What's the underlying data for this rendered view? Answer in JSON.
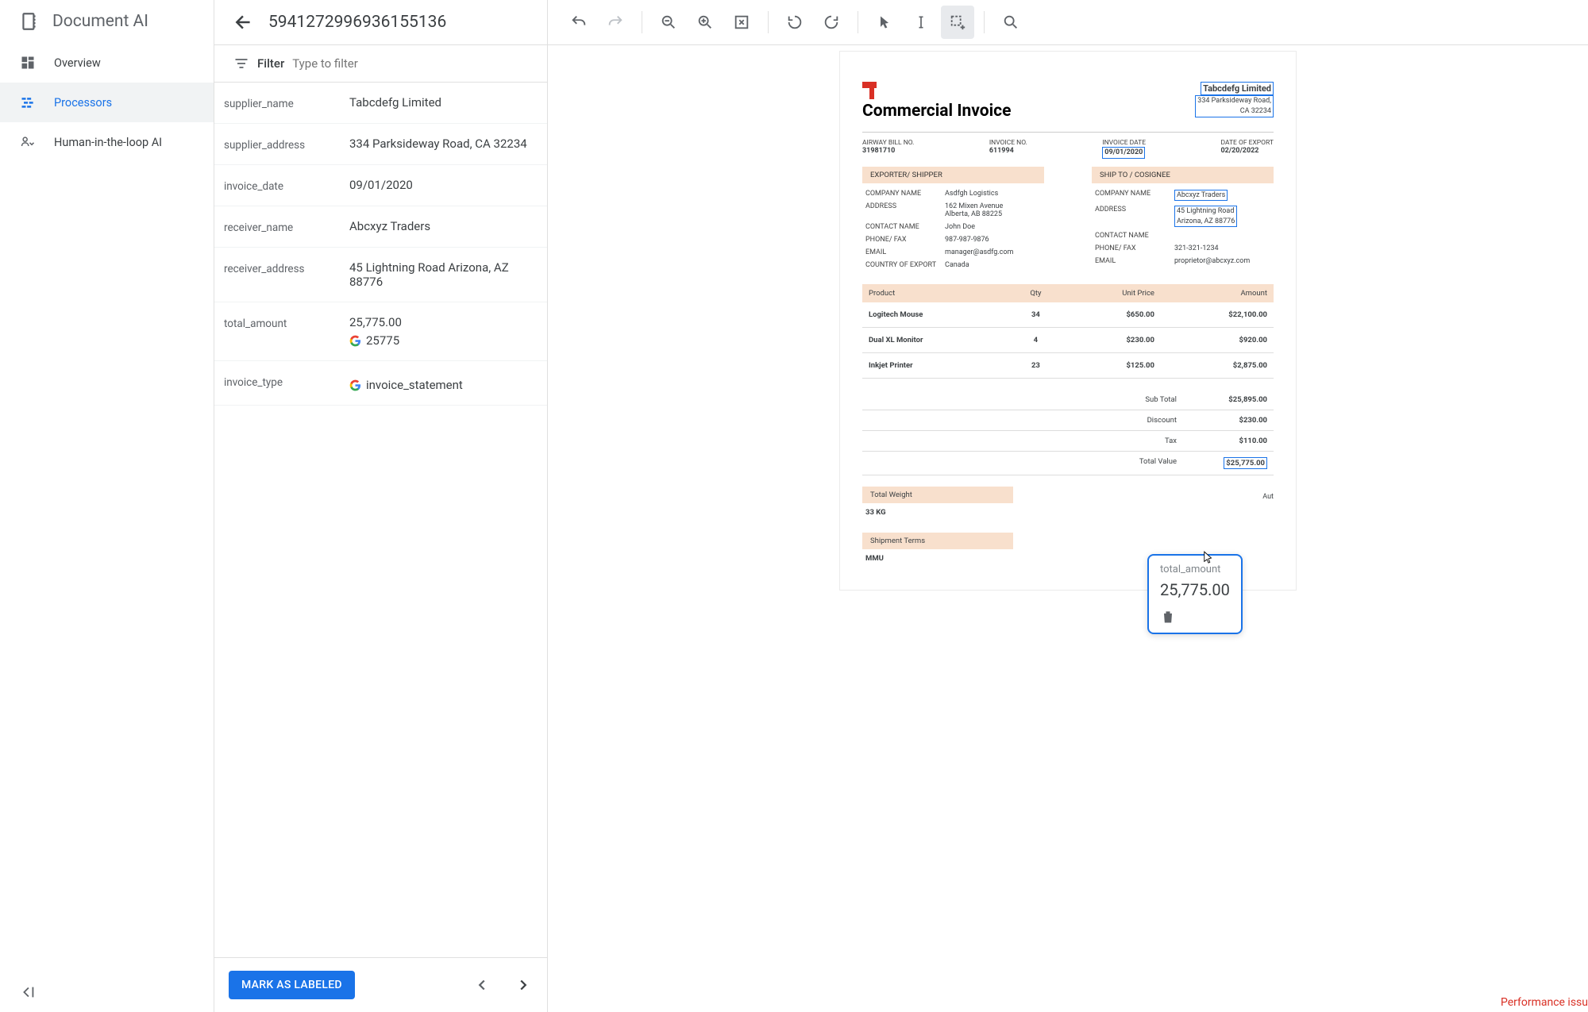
{
  "app": {
    "title": "Document AI"
  },
  "nav": {
    "items": [
      {
        "label": "Overview"
      },
      {
        "label": "Processors"
      },
      {
        "label": "Human-in-the-loop AI"
      }
    ]
  },
  "header": {
    "doc_id": "5941272996936155136"
  },
  "filter": {
    "label": "Filter",
    "placeholder": "Type to filter"
  },
  "fields": [
    {
      "name": "supplier_name",
      "value": "Tabcdefg Limited"
    },
    {
      "name": "supplier_address",
      "value": "334 Parksideway Road, CA 32234"
    },
    {
      "name": "invoice_date",
      "value": "09/01/2020"
    },
    {
      "name": "receiver_name",
      "value": "Abcxyz Traders"
    },
    {
      "name": "receiver_address",
      "value": "45 Lightning Road Arizona, AZ 88776"
    },
    {
      "name": "total_amount",
      "value": "25,775.00",
      "secondary": "25775"
    },
    {
      "name": "invoice_type",
      "secondary": "invoice_statement"
    }
  ],
  "actions": {
    "mark_labeled": "MARK AS LABELED"
  },
  "invoice": {
    "title": "Commercial Invoice",
    "supplier_name": "Tabcdefg Limited",
    "supplier_addr1": "334 Parksideway Road,",
    "supplier_addr2": "CA 32234",
    "meta": [
      {
        "label": "AIRWAY BILL NO.",
        "value": "31981710"
      },
      {
        "label": "INVOICE NO.",
        "value": "611994"
      },
      {
        "label": "INVOICE DATE",
        "value": "09/01/2020",
        "boxed": true
      },
      {
        "label": "DATE OF EXPORT",
        "value": "02/20/2022"
      }
    ],
    "exporter": {
      "header": "EXPORTER/ SHIPPER",
      "rows": [
        {
          "label": "COMPANY NAME",
          "value": "Asdfgh Logistics"
        },
        {
          "label": "ADDRESS",
          "value": "162 Mixen Avenue\nAlberta, AB 88225"
        },
        {
          "label": "CONTACT NAME",
          "value": "John Doe"
        },
        {
          "label": "PHONE/ FAX",
          "value": "987-987-9876"
        },
        {
          "label": "EMAIL",
          "value": "manager@asdfg.com"
        },
        {
          "label": "COUNTRY OF EXPORT",
          "value": "Canada"
        }
      ]
    },
    "shipto": {
      "header": "SHIP TO / COSIGNEE",
      "rows": [
        {
          "label": "COMPANY NAME",
          "value": "Abcxyz Traders",
          "boxed": true
        },
        {
          "label": "ADDRESS",
          "value": "45 Lightning Road\nArizona, AZ 88776",
          "boxed": true
        },
        {
          "label": "CONTACT NAME",
          "value": ""
        },
        {
          "label": "PHONE/ FAX",
          "value": "321-321-1234"
        },
        {
          "label": "EMAIL",
          "value": "proprietor@abcxyz.com"
        }
      ]
    },
    "table": {
      "headers": [
        "Product",
        "Qty",
        "Unit Price",
        "Amount"
      ],
      "rows": [
        [
          "Logitech Mouse",
          "34",
          "$650.00",
          "$22,100.00"
        ],
        [
          "Dual XL Monitor",
          "4",
          "$230.00",
          "$920.00"
        ],
        [
          "Inkjet Printer",
          "23",
          "$125.00",
          "$2,875.00"
        ]
      ]
    },
    "totals": [
      {
        "label": "Sub Total",
        "value": "$25,895.00"
      },
      {
        "label": "Discount",
        "value": "$230.00"
      },
      {
        "label": "Tax",
        "value": "$110.00"
      },
      {
        "label": "Total Value",
        "value": "$25,775.00",
        "boxed": true
      }
    ],
    "weight": {
      "header": "Total Weight",
      "value": "33 KG"
    },
    "terms": {
      "header": "Shipment Terms",
      "value": "MMU"
    },
    "auth": "Aut"
  },
  "popover": {
    "label": "total_amount",
    "value": "25,775.00"
  },
  "footer": {
    "perf": "Performance issu"
  }
}
